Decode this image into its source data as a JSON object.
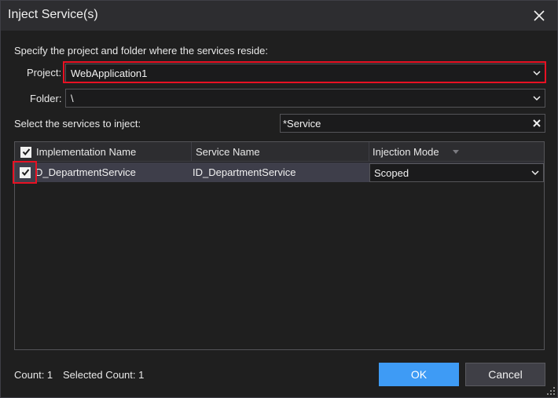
{
  "window": {
    "title": "Inject Service(s)"
  },
  "location": {
    "instruction": "Specify the project and folder where the services reside:",
    "project_label": "Project:",
    "project_value": "WebApplication1",
    "folder_label": "Folder:",
    "folder_value": "\\"
  },
  "services": {
    "label": "Select the services to inject:",
    "filter_value": "*Service"
  },
  "grid": {
    "columns": [
      "Implementation Name",
      "Service Name",
      "Injection Mode"
    ],
    "rows": [
      {
        "checked": true,
        "implementation": "D_DepartmentService",
        "service": "ID_DepartmentService",
        "mode": "Scoped"
      }
    ]
  },
  "footer": {
    "count": "Count: 1",
    "selected_count": "Selected Count: 1",
    "ok_label": "OK",
    "cancel_label": "Cancel"
  },
  "colors": {
    "accent": "#3e9bf5",
    "highlight_box": "#e81123",
    "background": "#1f1f1f"
  },
  "icons": [
    "close-icon",
    "chevron-down-icon",
    "clear-icon",
    "checkbox-checked-icon",
    "sort-arrow-icon",
    "resize-grip-icon"
  ]
}
